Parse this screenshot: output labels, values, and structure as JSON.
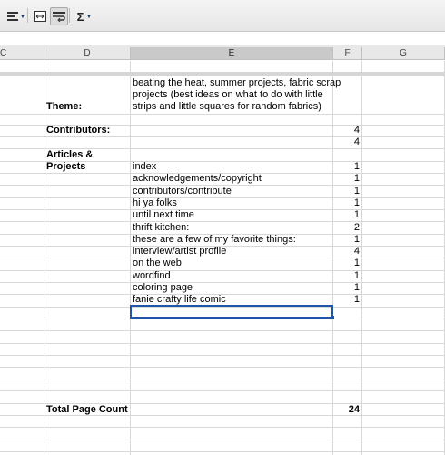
{
  "toolbar": {
    "align_icon": "align-left-icon",
    "wrap_icon": "merge-cells-icon",
    "wrap_active_icon": "wrap-text-icon",
    "sum_glyph": "Σ",
    "sum_icon": "sigma-icon",
    "dropdown_icon": "chevron-down-icon"
  },
  "columns": [
    "C",
    "D",
    "E",
    "F",
    "G"
  ],
  "sheet": {
    "theme_label": "Theme:",
    "theme_value_lines": [
      "beating the heat, summer projects, fabric scrap",
      "projects (best ideas on what to do with little",
      "strips and little squares for random fabrics)"
    ],
    "contributors_label": "Contributors:",
    "contributors_values": [
      "4",
      "4"
    ],
    "articles_label_lines": [
      "Articles &",
      "Projects"
    ],
    "articles": [
      {
        "title": "index",
        "pages": "1"
      },
      {
        "title": "acknowledgements/copyright",
        "pages": "1"
      },
      {
        "title": "contributors/contribute",
        "pages": "1"
      },
      {
        "title": "hi ya folks",
        "pages": "1"
      },
      {
        "title": "until next time",
        "pages": "1"
      },
      {
        "title": "thrift kitchen:",
        "pages": "2"
      },
      {
        "title": "these are a few of my favorite things:",
        "pages": "1"
      },
      {
        "title": "interview/artist profile",
        "pages": "4"
      },
      {
        "title": "on the web",
        "pages": "1"
      },
      {
        "title": "wordfind",
        "pages": "1"
      },
      {
        "title": "coloring page",
        "pages": "1"
      },
      {
        "title": "fanie crafty life comic",
        "pages": "1"
      }
    ],
    "total_label": "Total Page Count",
    "total_value": "24"
  }
}
